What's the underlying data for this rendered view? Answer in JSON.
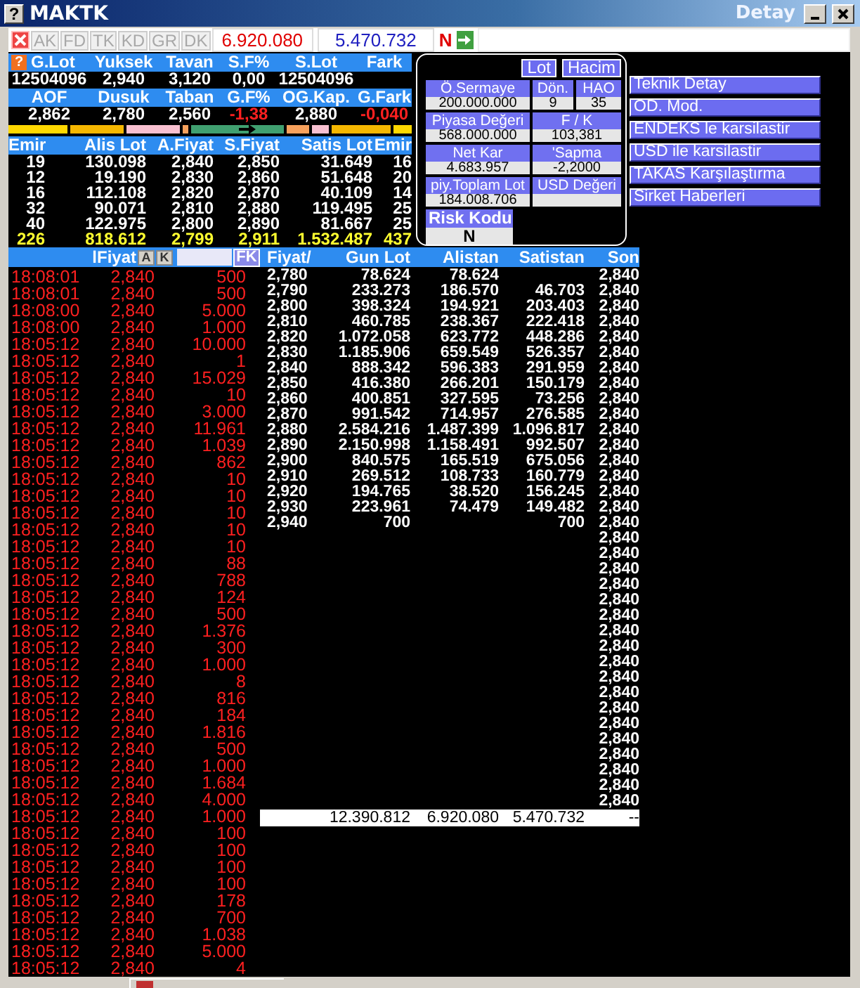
{
  "window": {
    "help_button": "?",
    "title": "MAKTK",
    "subtitle": "Detay"
  },
  "summary_help": "?",
  "toolbar": {
    "buttons": [
      "AK",
      "FD",
      "TK",
      "KD",
      "GR",
      "DK"
    ],
    "bid_total": "6.920.080",
    "ask_total": "5.470.732",
    "flag": "N"
  },
  "summary": [
    {
      "kind": "header",
      "cells": [
        "G.Lot",
        "Yuksek",
        "Tavan",
        "S.F%",
        "S.Lot",
        "Fark"
      ]
    },
    {
      "kind": "values",
      "cells": [
        {
          "text": "12504096",
          "negative": false
        },
        {
          "text": "2,940",
          "negative": false
        },
        {
          "text": "3,120",
          "negative": false
        },
        {
          "text": "0,00",
          "negative": false
        },
        {
          "text": "12504096",
          "negative": false
        }
      ]
    },
    {
      "kind": "header",
      "cells": [
        "AOF",
        "Dusuk",
        "Taban",
        "G.F%",
        "OG.Kap.",
        "G.Fark"
      ]
    },
    {
      "kind": "values",
      "cells": [
        {
          "text": "2,862",
          "negative": false
        },
        {
          "text": "2,780",
          "negative": false
        },
        {
          "text": "2,560",
          "negative": false
        },
        {
          "text": "-1,38",
          "negative": true
        },
        {
          "text": "2,880",
          "negative": false
        },
        {
          "text": "-0,040",
          "negative": true
        }
      ]
    }
  ],
  "order_book": {
    "columns": [
      "Emir",
      "Alis Lot",
      "A.Fiyat",
      "S.Fiyat",
      "Satis Lot",
      "Emir"
    ],
    "rows": [
      [
        "19",
        "130.098",
        "2,840",
        "2,850",
        "31.649",
        "16"
      ],
      [
        "12",
        "19.190",
        "2,830",
        "2,860",
        "51.648",
        "20"
      ],
      [
        "16",
        "112.108",
        "2,820",
        "2,870",
        "40.109",
        "14"
      ],
      [
        "32",
        "90.071",
        "2,810",
        "2,880",
        "119.495",
        "25"
      ],
      [
        "40",
        "122.975",
        "2,800",
        "2,890",
        "81.667",
        "25"
      ]
    ],
    "totals": [
      "226",
      "818.612",
      "2,799",
      "2,911",
      "1.532.487",
      "437"
    ]
  },
  "detail_panel": {
    "buttons": [
      "Lot",
      "Hacim"
    ],
    "rows": [
      [
        {
          "label": "Ö.Sermaye",
          "value": "200.000.000"
        },
        {
          "label": "Dön.",
          "value": "9"
        },
        {
          "label": "HAO",
          "value": "35"
        }
      ],
      [
        {
          "label": "Piyasa Değeri",
          "value": "568.000.000"
        },
        {
          "label": "F / K",
          "value": "103,381"
        }
      ],
      [
        {
          "label": "Net Kar",
          "value": "4.683.957"
        },
        {
          "label": "'Sapma",
          "value": "-2,2000"
        }
      ],
      [
        {
          "label": "piy.Toplam Lot",
          "value": "184.008.706"
        },
        {
          "label": "USD Değeri"
        }
      ]
    ],
    "risk": {
      "label": "Risk Kodu",
      "value": "N"
    }
  },
  "side_menu": [
    "Teknik Detay",
    "OD. Mod.",
    "ENDEKS le karsilastir",
    "USD ile karsilastir",
    "TAKAS Karşılaştırma",
    "Sirket Haberleri"
  ],
  "trades": {
    "column": "lFiyat",
    "buttons": [
      "A",
      "K"
    ],
    "filter_button": "FK",
    "rows": [
      {
        "time": "18:08:01",
        "price": "2,840",
        "lot": "500"
      },
      {
        "time": "18:08:01",
        "price": "2,840",
        "lot": "500"
      },
      {
        "time": "18:08:00",
        "price": "2,840",
        "lot": "5.000"
      },
      {
        "time": "18:08:00",
        "price": "2,840",
        "lot": "1.000"
      },
      {
        "time": "18:05:12",
        "price": "2,840",
        "lot": "10.000"
      },
      {
        "time": "18:05:12",
        "price": "2,840",
        "lot": "1"
      },
      {
        "time": "18:05:12",
        "price": "2,840",
        "lot": "15.029"
      },
      {
        "time": "18:05:12",
        "price": "2,840",
        "lot": "10"
      },
      {
        "time": "18:05:12",
        "price": "2,840",
        "lot": "3.000"
      },
      {
        "time": "18:05:12",
        "price": "2,840",
        "lot": "11.961"
      },
      {
        "time": "18:05:12",
        "price": "2,840",
        "lot": "1.039"
      },
      {
        "time": "18:05:12",
        "price": "2,840",
        "lot": "862"
      },
      {
        "time": "18:05:12",
        "price": "2,840",
        "lot": "10"
      },
      {
        "time": "18:05:12",
        "price": "2,840",
        "lot": "10"
      },
      {
        "time": "18:05:12",
        "price": "2,840",
        "lot": "10"
      },
      {
        "time": "18:05:12",
        "price": "2,840",
        "lot": "10"
      },
      {
        "time": "18:05:12",
        "price": "2,840",
        "lot": "10"
      },
      {
        "time": "18:05:12",
        "price": "2,840",
        "lot": "88"
      },
      {
        "time": "18:05:12",
        "price": "2,840",
        "lot": "788"
      },
      {
        "time": "18:05:12",
        "price": "2,840",
        "lot": "124"
      },
      {
        "time": "18:05:12",
        "price": "2,840",
        "lot": "500"
      },
      {
        "time": "18:05:12",
        "price": "2,840",
        "lot": "1.376"
      },
      {
        "time": "18:05:12",
        "price": "2,840",
        "lot": "300"
      },
      {
        "time": "18:05:12",
        "price": "2,840",
        "lot": "1.000"
      },
      {
        "time": "18:05:12",
        "price": "2,840",
        "lot": "8"
      },
      {
        "time": "18:05:12",
        "price": "2,840",
        "lot": "816"
      },
      {
        "time": "18:05:12",
        "price": "2,840",
        "lot": "184"
      },
      {
        "time": "18:05:12",
        "price": "2,840",
        "lot": "1.816"
      },
      {
        "time": "18:05:12",
        "price": "2,840",
        "lot": "500"
      },
      {
        "time": "18:05:12",
        "price": "2,840",
        "lot": "1.000"
      },
      {
        "time": "18:05:12",
        "price": "2,840",
        "lot": "1.684"
      },
      {
        "time": "18:05:12",
        "price": "2,840",
        "lot": "4.000"
      },
      {
        "time": "18:05:12",
        "price": "2,840",
        "lot": "1.000"
      },
      {
        "time": "18:05:12",
        "price": "2,840",
        "lot": "100"
      },
      {
        "time": "18:05:12",
        "price": "2,840",
        "lot": "100"
      },
      {
        "time": "18:05:12",
        "price": "2,840",
        "lot": "100"
      },
      {
        "time": "18:05:12",
        "price": "2,840",
        "lot": "100"
      },
      {
        "time": "18:05:12",
        "price": "2,840",
        "lot": "178"
      },
      {
        "time": "18:05:12",
        "price": "2,840",
        "lot": "700"
      },
      {
        "time": "18:05:12",
        "price": "2,840",
        "lot": "1.038"
      },
      {
        "time": "18:05:12",
        "price": "2,840",
        "lot": "5.000"
      },
      {
        "time": "18:05:12",
        "price": "2,840",
        "lot": "4"
      }
    ]
  },
  "price_table": {
    "columns": [
      "Fiyat/",
      "Gun Lot",
      "Alistan",
      "Satistan",
      "Son"
    ],
    "rows": [
      {
        "price": "2,780",
        "gun_lot": "78.624",
        "alistan": "78.624",
        "son": "2,840"
      },
      {
        "price": "2,790",
        "gun_lot": "233.273",
        "alistan": "186.570",
        "satistan": "46.703",
        "son": "2,840"
      },
      {
        "price": "2,800",
        "gun_lot": "398.324",
        "alistan": "194.921",
        "satistan": "203.403",
        "son": "2,840"
      },
      {
        "price": "2,810",
        "gun_lot": "460.785",
        "alistan": "238.367",
        "satistan": "222.418",
        "son": "2,840"
      },
      {
        "price": "2,820",
        "gun_lot": "1.072.058",
        "alistan": "623.772",
        "satistan": "448.286",
        "son": "2,840"
      },
      {
        "price": "2,830",
        "gun_lot": "1.185.906",
        "alistan": "659.549",
        "satistan": "526.357",
        "son": "2,840"
      },
      {
        "price": "2,840",
        "gun_lot": "888.342",
        "alistan": "596.383",
        "satistan": "291.959",
        "son": "2,840"
      },
      {
        "price": "2,850",
        "gun_lot": "416.380",
        "alistan": "266.201",
        "satistan": "150.179",
        "son": "2,840"
      },
      {
        "price": "2,860",
        "gun_lot": "400.851",
        "alistan": "327.595",
        "satistan": "73.256",
        "son": "2,840"
      },
      {
        "price": "2,870",
        "gun_lot": "991.542",
        "alistan": "714.957",
        "satistan": "276.585",
        "son": "2,840"
      },
      {
        "price": "2,880",
        "gun_lot": "2.584.216",
        "alistan": "1.487.399",
        "satistan": "1.096.817",
        "son": "2,840"
      },
      {
        "price": "2,890",
        "gun_lot": "2.150.998",
        "alistan": "1.158.491",
        "satistan": "992.507",
        "son": "2,840"
      },
      {
        "price": "2,900",
        "gun_lot": "840.575",
        "alistan": "165.519",
        "satistan": "675.056",
        "son": "2,840"
      },
      {
        "price": "2,910",
        "gun_lot": "269.512",
        "alistan": "108.733",
        "satistan": "160.779",
        "son": "2,840"
      },
      {
        "price": "2,920",
        "gun_lot": "194.765",
        "alistan": "38.520",
        "satistan": "156.245",
        "son": "2,840"
      },
      {
        "price": "2,930",
        "gun_lot": "223.961",
        "alistan": "74.479",
        "satistan": "149.482",
        "son": "2,840"
      },
      {
        "price": "2,940",
        "gun_lot": "700",
        "satistan": "700",
        "son": "2,840"
      },
      {
        "son": "2,840"
      },
      {
        "son": "2,840"
      },
      {
        "son": "2,840"
      },
      {
        "son": "2,840"
      },
      {
        "son": "2,840"
      },
      {
        "son": "2,840"
      },
      {
        "son": "2,840"
      },
      {
        "son": "2,840"
      },
      {
        "son": "2,840"
      },
      {
        "son": "2,840"
      },
      {
        "son": "2,840"
      },
      {
        "son": "2,840"
      },
      {
        "son": "2,840"
      },
      {
        "son": "2,840"
      },
      {
        "son": "2,840"
      },
      {
        "son": "2,840"
      },
      {
        "son": "2,840"
      },
      {
        "son": "2,840"
      }
    ],
    "totals": {
      "gun_lot": "12.390.812",
      "alistan": "6.920.080",
      "satistan": "5.470.732",
      "son": "--"
    }
  }
}
